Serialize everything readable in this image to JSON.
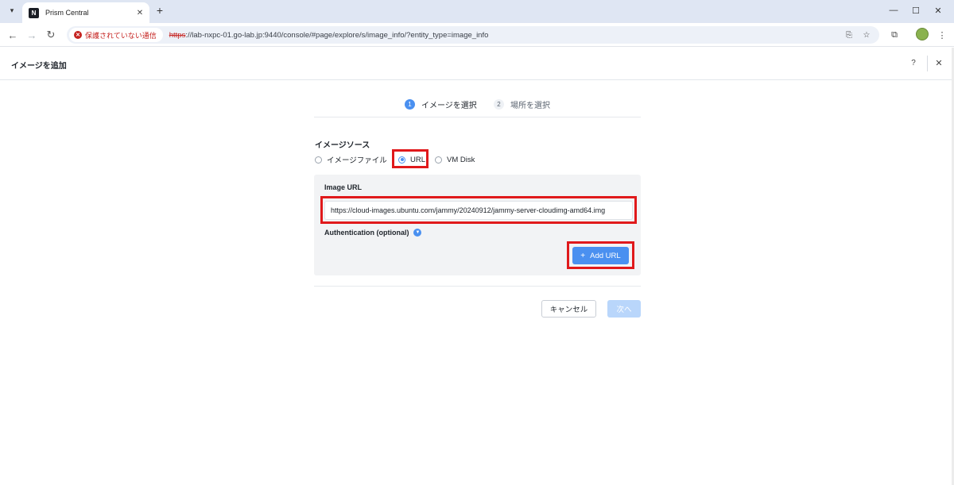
{
  "browser": {
    "tab_title": "Prism Central",
    "favicon_text": "N",
    "security_text": "保護されていない通信",
    "url_scheme": "https",
    "url_rest": "://lab-nxpc-01.go-lab.jp:9440/console/#page/explore/s/image_info/?entity_type=image_info"
  },
  "header": {
    "title": "イメージを追加",
    "help": "?",
    "close": "✕"
  },
  "steps": [
    {
      "num": "1",
      "label": "イメージを選択",
      "active": true
    },
    {
      "num": "2",
      "label": "場所を選択",
      "active": false
    }
  ],
  "form": {
    "source_label": "イメージソース",
    "radios": [
      {
        "label": "イメージファイル",
        "checked": false
      },
      {
        "label": "URL",
        "checked": true
      },
      {
        "label": "VM Disk",
        "checked": false
      }
    ],
    "image_url_label": "Image URL",
    "image_url_value": "https://cloud-images.ubuntu.com/jammy/20240912/jammy-server-cloudimg-amd64.img",
    "auth_label": "Authentication (optional)",
    "add_url_label": "Add URL",
    "add_url_plus": "+"
  },
  "footer": {
    "cancel_label": "キャンセル",
    "next_label": "次へ"
  },
  "colors": {
    "accent": "#4a90f0",
    "highlight": "#e0191b",
    "warning": "#c5221f"
  }
}
